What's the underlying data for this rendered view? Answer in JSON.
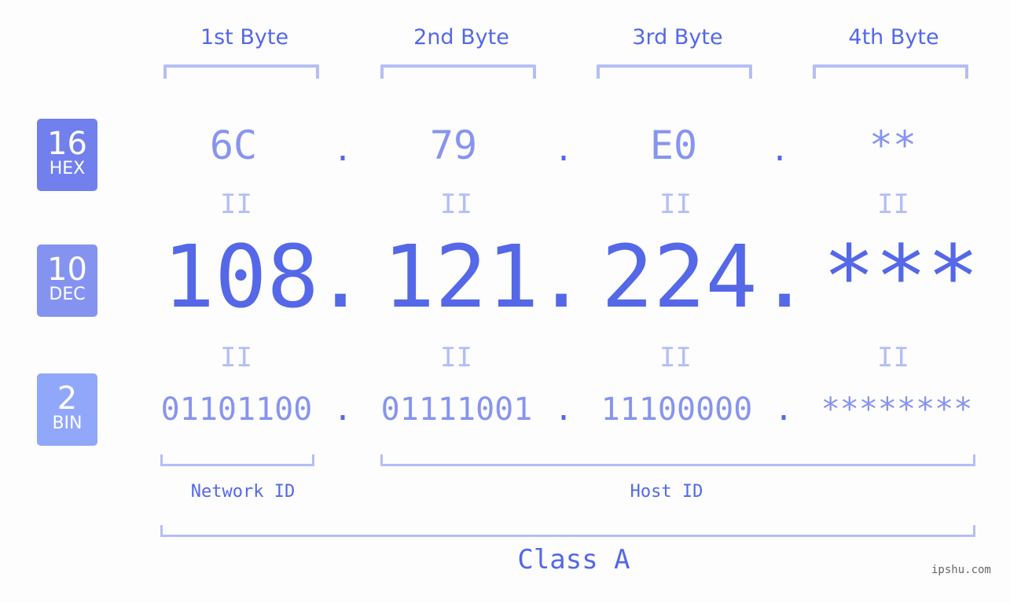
{
  "byte_headers": [
    "1st Byte",
    "2nd Byte",
    "3rd Byte",
    "4th Byte"
  ],
  "badges": {
    "hex": {
      "num": "16",
      "label": "HEX",
      "color": "#7180ec"
    },
    "dec": {
      "num": "10",
      "label": "DEC",
      "color": "#8593f0"
    },
    "bin": {
      "num": "2",
      "label": "BIN",
      "color": "#91a7fa"
    }
  },
  "hex": [
    "6C",
    "79",
    "E0",
    "**"
  ],
  "dec": [
    "108",
    "121",
    "224",
    "***"
  ],
  "bin": [
    "01101100",
    "01111001",
    "11100000",
    "********"
  ],
  "separator": ".",
  "equals": "II",
  "network_label": "Network ID",
  "host_label": "Host ID",
  "class_label": "Class A",
  "watermark": "ipshu.com"
}
